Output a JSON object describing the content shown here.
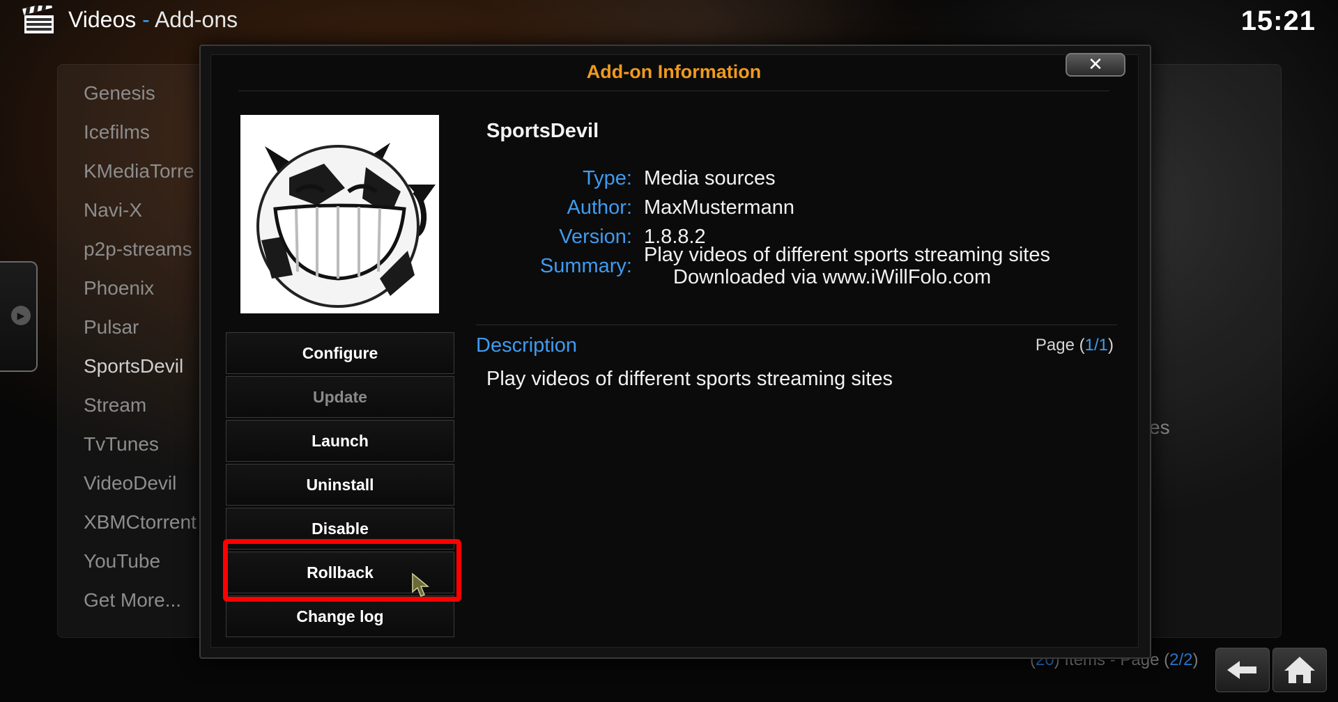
{
  "header": {
    "section": "Videos",
    "separator": "-",
    "subsection": "Add-ons",
    "clock": "15:21",
    "icon": "clapperboard-icon"
  },
  "background_list": {
    "items": [
      "Genesis",
      "Icefilms",
      "KMediaTorre",
      "Navi-X",
      "p2p-streams",
      "Phoenix",
      "Pulsar",
      "SportsDevil",
      "Stream",
      "TvTunes",
      "VideoDevil",
      "XBMCtorrent",
      "YouTube",
      "Get More..."
    ],
    "active_item": "SportsDevil",
    "right_partial_text": "ites",
    "footer": {
      "count": "20",
      "items_label": "Items - Page",
      "page": "2/2"
    }
  },
  "dialog": {
    "title": "Add-on Information",
    "close_label": "✕",
    "addon_name": "SportsDevil",
    "type_label": "Type:",
    "type_value": "Media sources",
    "author_label": "Author:",
    "author_value": "MaxMustermann",
    "version_label": "Version:",
    "version_value": "1.8.8.2",
    "summary_label": "Summary:",
    "summary_line1": "Play videos of different sports streaming sites",
    "summary_line2": "Downloaded via www.iWillFolo.com",
    "description_header": "Description",
    "page_label": "Page",
    "page_value": "1/1",
    "description_text": "Play videos of different sports streaming sites",
    "buttons": {
      "configure": "Configure",
      "update": "Update",
      "launch": "Launch",
      "uninstall": "Uninstall",
      "disable": "Disable",
      "rollback": "Rollback",
      "changelog": "Change log"
    }
  },
  "colors": {
    "accent_blue": "#3f9bf0",
    "title_orange": "#ef9a1e",
    "highlight_red": "#ff0000"
  }
}
